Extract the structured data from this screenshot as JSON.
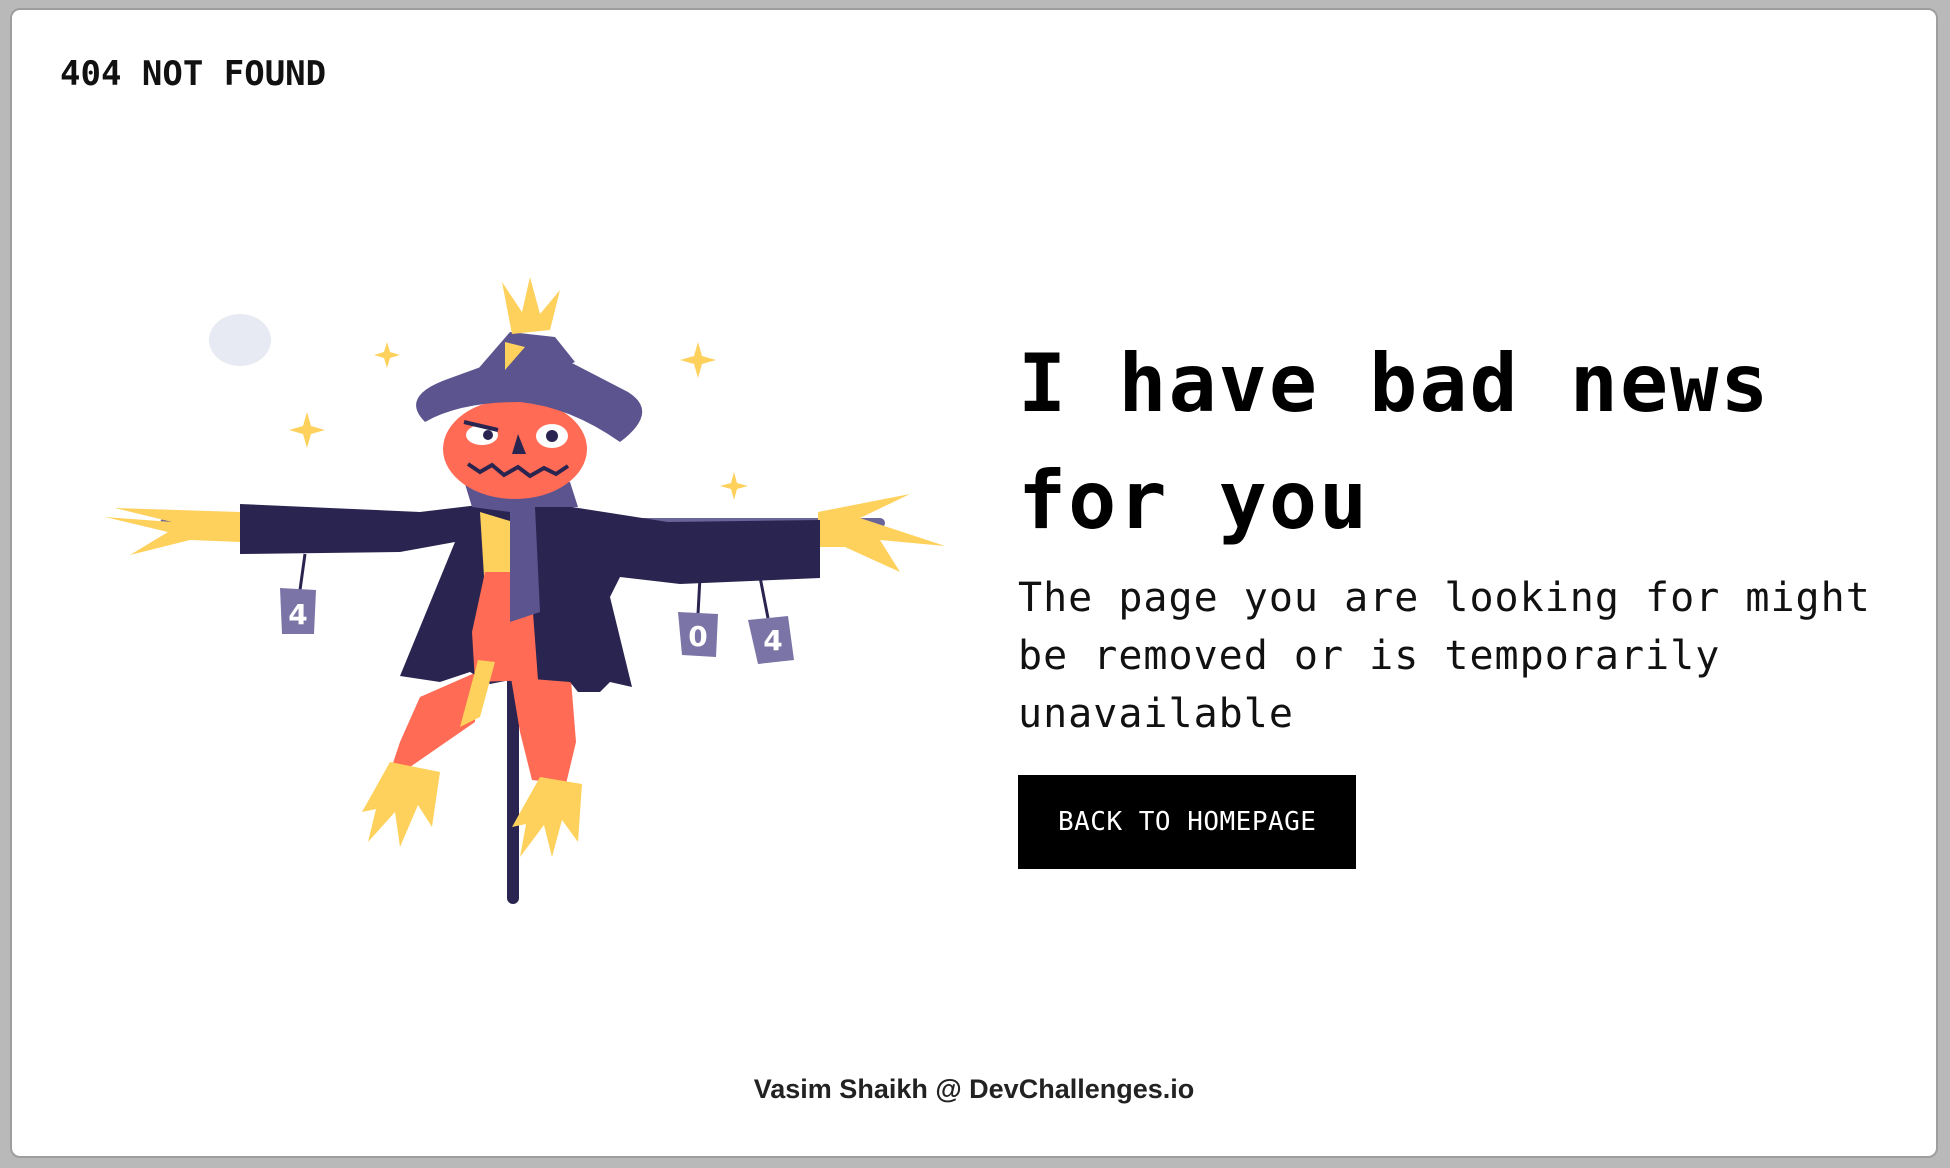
{
  "header": {
    "title": "404 NOT FOUND"
  },
  "main": {
    "headline": "I have bad news for you",
    "message": "The page you are looking for might be removed or is temporarily unavailable",
    "button_label": "BACK TO HOMEPAGE"
  },
  "illustration": {
    "can_digits": [
      "4",
      "0",
      "4"
    ],
    "colors": {
      "hat": "#5c548f",
      "face": "#ff6b55",
      "coat": "#2a2550",
      "straw": "#fdd15c",
      "scarf": "#5c548f",
      "pole": "#2a2550",
      "cans": "#7b74a6"
    }
  },
  "footer": {
    "credit": "Vasim Shaikh @ DevChallenges.io"
  }
}
